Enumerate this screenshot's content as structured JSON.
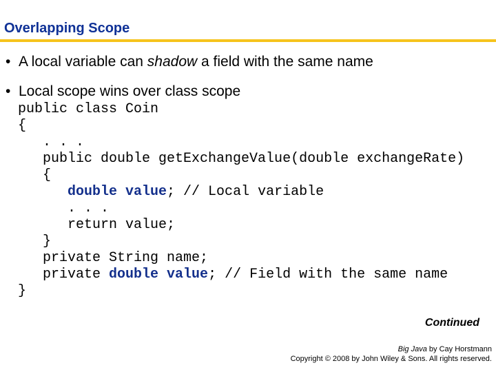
{
  "slide": {
    "title": "Overlapping Scope",
    "accent_colors": {
      "title": "#0f3196",
      "rule": "#f6c31c",
      "keyword": "#14308c"
    },
    "bullets": [
      {
        "before": "A local variable can ",
        "emphasis": "shadow",
        "after": " a field with the same name"
      },
      {
        "text": "Local scope wins over class scope"
      }
    ],
    "bullet_glyph": "•",
    "code": {
      "lines": [
        {
          "plain": "public class Coin"
        },
        {
          "plain": "{"
        },
        {
          "plain": "   . . ."
        },
        {
          "plain": "   public double getExchangeValue(double exchangeRate)"
        },
        {
          "plain": "   {"
        },
        {
          "pre": "      ",
          "highlight": "double value",
          "post": "; // Local variable"
        },
        {
          "plain": "      . . ."
        },
        {
          "plain": "      return value;"
        },
        {
          "plain": "   }"
        },
        {
          "plain": "   private String name;"
        },
        {
          "pre": "   private ",
          "highlight": "double value",
          "post": "; // Field with the same name"
        },
        {
          "plain": "}"
        }
      ]
    },
    "continued_label": "Continued",
    "credit": {
      "book_title": "Big Java",
      "book_author": " by Cay Horstmann",
      "copyright": "Copyright © 2008 by John Wiley & Sons.  All rights reserved."
    }
  }
}
